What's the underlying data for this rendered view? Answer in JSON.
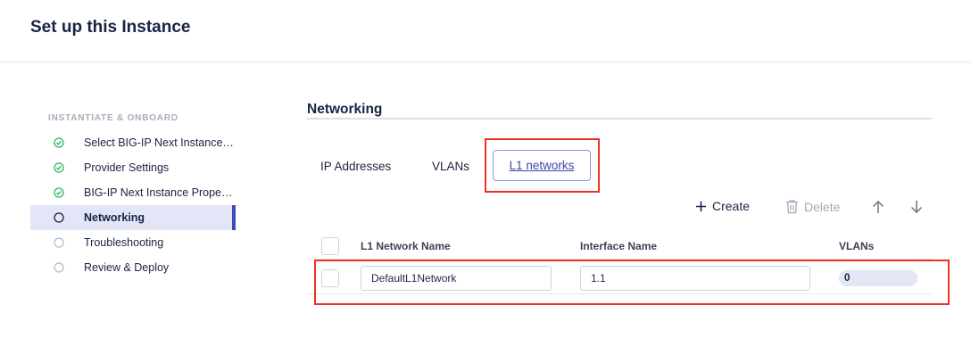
{
  "header": {
    "title": "Set up this Instance"
  },
  "sidebar": {
    "section_label": "INSTANTIATE & ONBOARD",
    "steps": [
      {
        "label": "Select BIG-IP Next Instance Template",
        "status": "complete"
      },
      {
        "label": "Provider Settings",
        "status": "complete"
      },
      {
        "label": "BIG-IP Next Instance Properties",
        "status": "complete"
      },
      {
        "label": "Networking",
        "status": "current"
      },
      {
        "label": "Troubleshooting",
        "status": "pending"
      },
      {
        "label": "Review & Deploy",
        "status": "pending"
      }
    ]
  },
  "main": {
    "section_title": "Networking",
    "tabs": [
      {
        "label": "IP Addresses",
        "active": false
      },
      {
        "label": "VLANs",
        "active": false
      },
      {
        "label": "L1 networks",
        "active": true
      }
    ],
    "toolbar": {
      "create_label": "Create",
      "delete_label": "Delete",
      "icons": [
        "plus-icon",
        "trash-icon",
        "arrow-up-icon",
        "arrow-down-icon"
      ]
    },
    "table": {
      "columns": [
        "L1 Network Name",
        "Interface Name",
        "VLANs"
      ],
      "rows": [
        {
          "name": "DefaultL1Network",
          "interface": "1.1",
          "vlans": "0"
        }
      ]
    }
  },
  "colors": {
    "accent": "#3b4bb8",
    "complete_green": "#2fb562",
    "highlight_red": "#ea3323"
  }
}
